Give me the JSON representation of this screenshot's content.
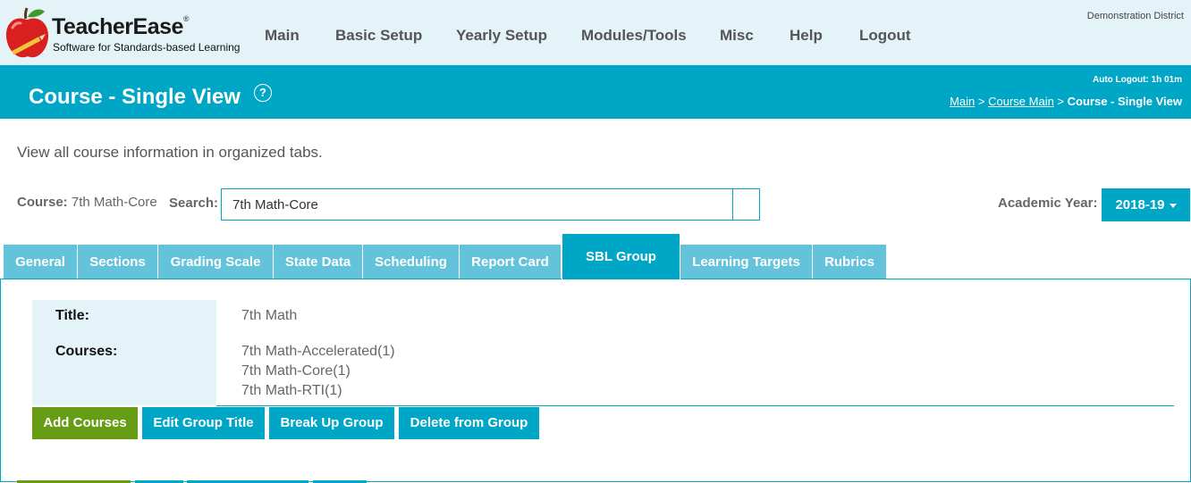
{
  "header": {
    "brand_name": "TeacherEase",
    "brand_reg": "®",
    "brand_tagline": "Software for Standards-based Learning",
    "district": "Demonstration District",
    "nav": [
      {
        "label": "Main"
      },
      {
        "label": "Basic Setup"
      },
      {
        "label": "Yearly Setup"
      },
      {
        "label": "Modules/Tools"
      },
      {
        "label": "Misc"
      },
      {
        "label": "Help"
      },
      {
        "label": "Logout"
      }
    ]
  },
  "titlebar": {
    "title": "Course - Single View",
    "help_glyph": "?",
    "auto_logout": "Auto Logout: 1h 01m",
    "breadcrumb": {
      "main": "Main",
      "sep1": " > ",
      "course_main": "Course Main",
      "sep2": " > ",
      "current": "Course - Single View"
    }
  },
  "content": {
    "description": "View all course information in organized tabs.",
    "course_label": "Course:",
    "course_value": "7th Math-Core",
    "search_label": "Search:",
    "search_value": "7th Math-Core",
    "academic_year_label": "Academic Year:",
    "academic_year_value": "2018-19"
  },
  "tabs": [
    {
      "label": "General"
    },
    {
      "label": "Sections"
    },
    {
      "label": "Grading Scale"
    },
    {
      "label": "State Data"
    },
    {
      "label": "Scheduling"
    },
    {
      "label": "Report Card"
    },
    {
      "label": "SBL Group"
    },
    {
      "label": "Learning Targets"
    },
    {
      "label": "Rubrics"
    }
  ],
  "active_tab": "SBL Group",
  "sbl_group": {
    "title_label": "Title:",
    "title_value": "7th Math",
    "courses_label": "Courses:",
    "courses": [
      "7th Math-Accelerated(1)",
      "7th Math-Core(1)",
      "7th Math-RTI(1)"
    ]
  },
  "actions": {
    "add_courses": "Add Courses",
    "edit_group_title": "Edit Group Title",
    "break_up_group": "Break Up Group",
    "delete_from_group": "Delete from Group"
  },
  "colors": {
    "accent": "#00a6c6",
    "tab_inactive": "#62c3da",
    "header_bg": "#e4f3f8",
    "add_button": "#669d14"
  }
}
